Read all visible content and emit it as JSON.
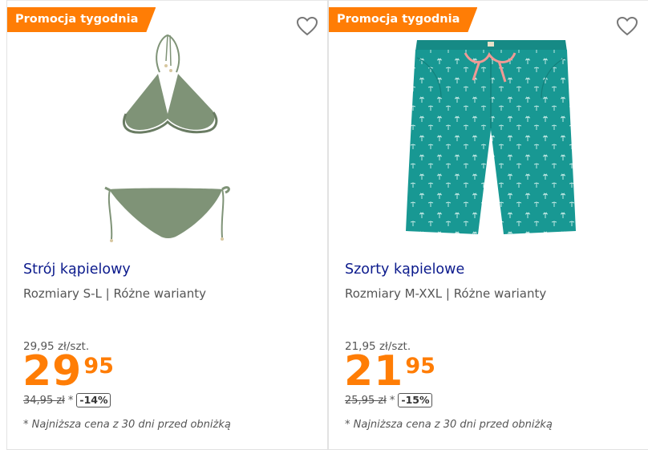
{
  "products": [
    {
      "badge": "Promocja tygodnia",
      "title": "Strój kąpielowy",
      "variant": "Rozmiary S-L | Różne warianty",
      "unit_price": "29,95 zł/szt.",
      "price_int": "29",
      "price_dec": "95",
      "old_price": "34,95 zł",
      "old_price_marker": "*",
      "discount": "-14%",
      "footnote": "* Najniższa cena z 30 dni przed obniżką",
      "image": "bikini"
    },
    {
      "badge": "Promocja tygodnia",
      "title": "Szorty kąpielowe",
      "variant": "Rozmiary M-XXL | Różne warianty",
      "unit_price": "21,95 zł/szt.",
      "price_int": "21",
      "price_dec": "95",
      "old_price": "25,95 zł",
      "old_price_marker": "*",
      "discount": "-15%",
      "footnote": "* Najniższa cena z 30 dni przed obniżką",
      "image": "swim-shorts"
    }
  ],
  "colors": {
    "accent": "#ff7d05",
    "title": "#0b1a8c",
    "bikini": "#7f9377",
    "shorts": "#189893"
  },
  "icons": {
    "favorite": "heart-outline-icon"
  }
}
